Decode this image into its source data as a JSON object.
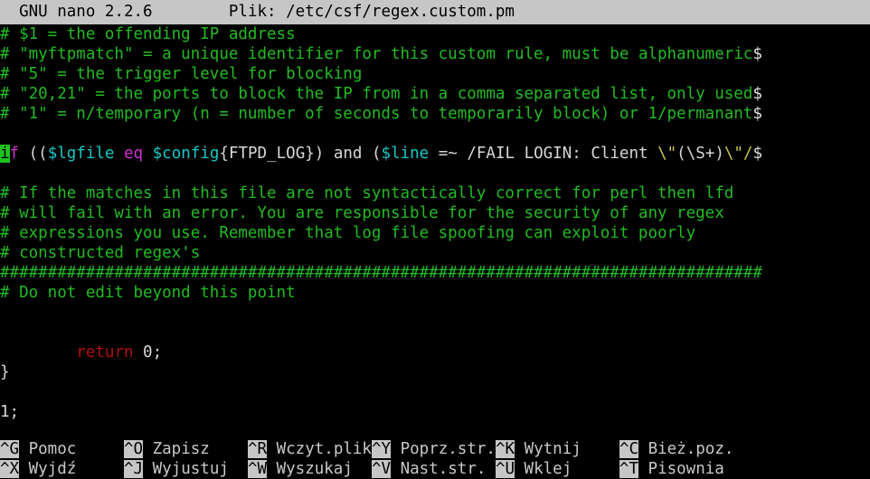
{
  "window": {
    "app_title": "GNU nano 2.2.6",
    "file_label": "Plik: /etc/csf/regex.custom.pm",
    "columns": 80,
    "rows": 24
  },
  "colors": {
    "background": "#000000",
    "foreground": "#d8d8d8",
    "titlebar_bg": "#c6c6c6",
    "titlebar_fg": "#000000",
    "comment": "#22bb22",
    "keyword": "#d030d0",
    "variable": "#16c7c7",
    "string": "#c5c54b",
    "red": "#b01010",
    "cursor_bg": "#1ec41e",
    "cursor_fg": "#000000",
    "key_bg": "#c6c6c6",
    "key_fg": "#000000",
    "label_fg": "#c8c8c8"
  },
  "editor": {
    "cursor": {
      "line": 6,
      "column": 0
    },
    "truncation_marker": "$",
    "lines": [
      {
        "index": 0,
        "truncated": false,
        "segments": [
          {
            "text": "# $1 = the offending IP address",
            "style": "comment"
          }
        ]
      },
      {
        "index": 1,
        "truncated": true,
        "segments": [
          {
            "text": "# \"myftpmatch\" = a unique identifier for this custom rule, must be alphanumeric",
            "style": "comment"
          }
        ]
      },
      {
        "index": 2,
        "truncated": false,
        "segments": [
          {
            "text": "# \"5\" = the trigger level for blocking",
            "style": "comment"
          }
        ]
      },
      {
        "index": 3,
        "truncated": true,
        "segments": [
          {
            "text": "# \"20,21\" = the ports to block the IP from in a comma separated list, only used",
            "style": "comment"
          }
        ]
      },
      {
        "index": 4,
        "truncated": true,
        "segments": [
          {
            "text": "# \"1\" = n/temporary (n = number of seconds to temporarily block) or 1/permanant",
            "style": "comment"
          }
        ]
      },
      {
        "index": 5,
        "truncated": false,
        "segments": []
      },
      {
        "index": 6,
        "truncated": true,
        "segments": [
          {
            "text": "i",
            "style": "cursor"
          },
          {
            "text": "f",
            "style": "keyword"
          },
          {
            "text": " ((",
            "style": "plain"
          },
          {
            "text": "$lgfile",
            "style": "variable"
          },
          {
            "text": " ",
            "style": "plain"
          },
          {
            "text": "eq",
            "style": "keyword"
          },
          {
            "text": " ",
            "style": "plain"
          },
          {
            "text": "$config",
            "style": "variable"
          },
          {
            "text": "{FTPD_LOG}) and (",
            "style": "plain"
          },
          {
            "text": "$line",
            "style": "variable"
          },
          {
            "text": " =~ /FAIL LOGIN: Client ",
            "style": "plain"
          },
          {
            "text": "\\\"",
            "style": "string"
          },
          {
            "text": "(\\S+)",
            "style": "plain"
          },
          {
            "text": "\\\"/",
            "style": "string"
          }
        ]
      },
      {
        "index": 7,
        "truncated": false,
        "segments": []
      },
      {
        "index": 8,
        "truncated": false,
        "segments": [
          {
            "text": "# If the matches in this file are not syntactically correct for perl then lfd",
            "style": "comment"
          }
        ]
      },
      {
        "index": 9,
        "truncated": false,
        "segments": [
          {
            "text": "# will fail with an error. You are responsible for the security of any regex",
            "style": "comment"
          }
        ]
      },
      {
        "index": 10,
        "truncated": false,
        "segments": [
          {
            "text": "# expressions you use. Remember that log file spoofing can exploit poorly",
            "style": "comment"
          }
        ]
      },
      {
        "index": 11,
        "truncated": false,
        "segments": [
          {
            "text": "# constructed regex's",
            "style": "comment"
          }
        ]
      },
      {
        "index": 12,
        "truncated": false,
        "segments": [
          {
            "text": "################################################################################",
            "style": "comment"
          }
        ]
      },
      {
        "index": 13,
        "truncated": false,
        "segments": [
          {
            "text": "# Do not edit beyond this point",
            "style": "comment"
          }
        ]
      },
      {
        "index": 14,
        "truncated": false,
        "segments": []
      },
      {
        "index": 15,
        "truncated": false,
        "segments": []
      },
      {
        "index": 16,
        "truncated": false,
        "segments": [
          {
            "text": "        ",
            "style": "plain"
          },
          {
            "text": "return",
            "style": "red"
          },
          {
            "text": " 0;",
            "style": "plain"
          }
        ]
      },
      {
        "index": 17,
        "truncated": false,
        "segments": [
          {
            "text": "}",
            "style": "plain"
          }
        ]
      },
      {
        "index": 18,
        "truncated": false,
        "segments": []
      },
      {
        "index": 19,
        "truncated": false,
        "segments": [
          {
            "text": "1;",
            "style": "plain"
          }
        ]
      },
      {
        "index": 20,
        "truncated": false,
        "segments": []
      }
    ]
  },
  "footer": {
    "rows": [
      [
        {
          "key": "^G",
          "label": "Pomoc",
          "col": 0
        },
        {
          "key": "^O",
          "label": "Zapisz",
          "col": 13
        },
        {
          "key": "^R",
          "label": "Wczyt.plik",
          "col": 26
        },
        {
          "key": "^Y",
          "label": "Poprz.str.",
          "col": 39
        },
        {
          "key": "^K",
          "label": "Wytnij",
          "col": 52
        },
        {
          "key": "^C",
          "label": "Bież.poz.",
          "col": 65
        }
      ],
      [
        {
          "key": "^X",
          "label": "Wyjdź",
          "col": 0
        },
        {
          "key": "^J",
          "label": "Wyjustuj",
          "col": 13
        },
        {
          "key": "^W",
          "label": "Wyszukaj",
          "col": 26
        },
        {
          "key": "^V",
          "label": "Nast.str.",
          "col": 39
        },
        {
          "key": "^U",
          "label": "Wklej",
          "col": 52
        },
        {
          "key": "^T",
          "label": "Pisownia",
          "col": 65
        }
      ]
    ]
  }
}
